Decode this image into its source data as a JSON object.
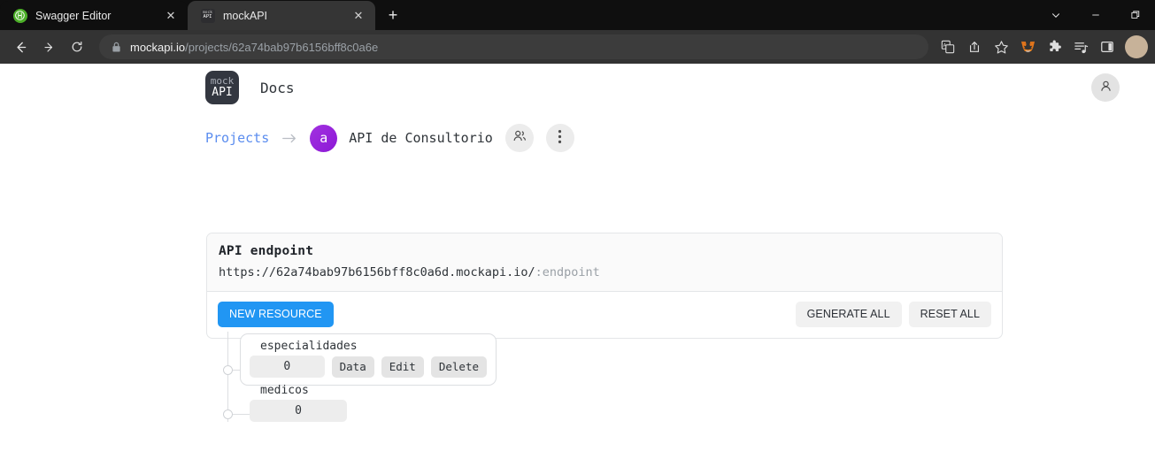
{
  "browser": {
    "tabs": [
      {
        "title": "Swagger Editor",
        "favicon": "swagger-icon",
        "active": false
      },
      {
        "title": "mockAPI",
        "favicon": "mockapi-icon",
        "active": true
      }
    ],
    "new_tab_label": "+",
    "close_label": "✕",
    "window_controls": [
      "chevron-down-icon",
      "minimize-icon",
      "restore-icon"
    ],
    "nav": {
      "back": "back-icon",
      "forward": "forward-icon",
      "reload": "reload-icon"
    },
    "url": {
      "lock": "lock-icon",
      "domain": "mockapi.io",
      "path": "/projects/62a74bab97b6156bff8c0a6e"
    },
    "toolbar_icons": [
      "translate-icon",
      "share-icon",
      "bookmark-star-icon",
      "metamask-icon",
      "extensions-icon",
      "reading-list-icon",
      "side-panel-icon"
    ]
  },
  "header": {
    "logo_top": "mock",
    "logo_bottom": "API",
    "docs_label": "Docs",
    "account_icon": "user-icon"
  },
  "breadcrumb": {
    "projects_label": "Projects",
    "arrow": "arrow-right-icon",
    "project_initial": "a",
    "project_name": "API de Consultorio",
    "members_icon": "people-icon",
    "more_icon": "three-dots-icon"
  },
  "endpoint_card": {
    "title": "API endpoint",
    "url_base": "https://62a74bab97b6156bff8c0a6d.mockapi.io/",
    "url_param": ":endpoint",
    "new_resource_label": "NEW RESOURCE",
    "generate_all_label": "GENERATE ALL",
    "reset_all_label": "RESET ALL"
  },
  "resources": [
    {
      "name": "especialidades",
      "count": "0",
      "hovered": true,
      "actions": [
        {
          "label": "Data"
        },
        {
          "label": "Edit"
        },
        {
          "label": "Delete"
        }
      ]
    },
    {
      "name": "medicos",
      "count": "0",
      "hovered": false,
      "actions": []
    }
  ],
  "colors": {
    "accent_blue": "#2196f3",
    "link_blue": "#5b8def",
    "avatar_purple": "#8c18d6",
    "chrome_toolbar": "#333333",
    "tab_active": "#353535"
  }
}
